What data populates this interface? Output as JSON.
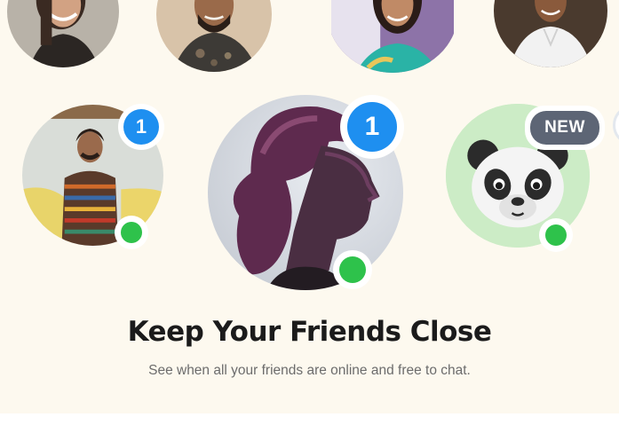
{
  "feature": {
    "title": "Keep Your Friends Close",
    "subtitle": "See when all your friends are online and free to chat."
  },
  "friends_top_row": [
    {
      "name": "friend-top-1",
      "photo": "smiling-woman-photo"
    },
    {
      "name": "friend-top-2",
      "photo": "bearded-man-photo"
    },
    {
      "name": "friend-top-3",
      "photo": "woman-purple-background-photo"
    },
    {
      "name": "friend-top-4",
      "photo": "man-white-shirt-photo"
    }
  ],
  "friends_featured": [
    {
      "photo": "man-sweater-photo",
      "unread_count": "1",
      "status": "online"
    },
    {
      "photo": "woman-profile-purple-photo",
      "unread_count": "1",
      "status": "online"
    },
    {
      "photo": "panda-emoji-avatar",
      "badge": "NEW",
      "status": "online"
    }
  ],
  "colors": {
    "background": "#fdf9ef",
    "unread_badge": "#1e8ff0",
    "online": "#2ec24b",
    "new_badge": "#5d6575",
    "panda_bg": "#ccecc6"
  }
}
